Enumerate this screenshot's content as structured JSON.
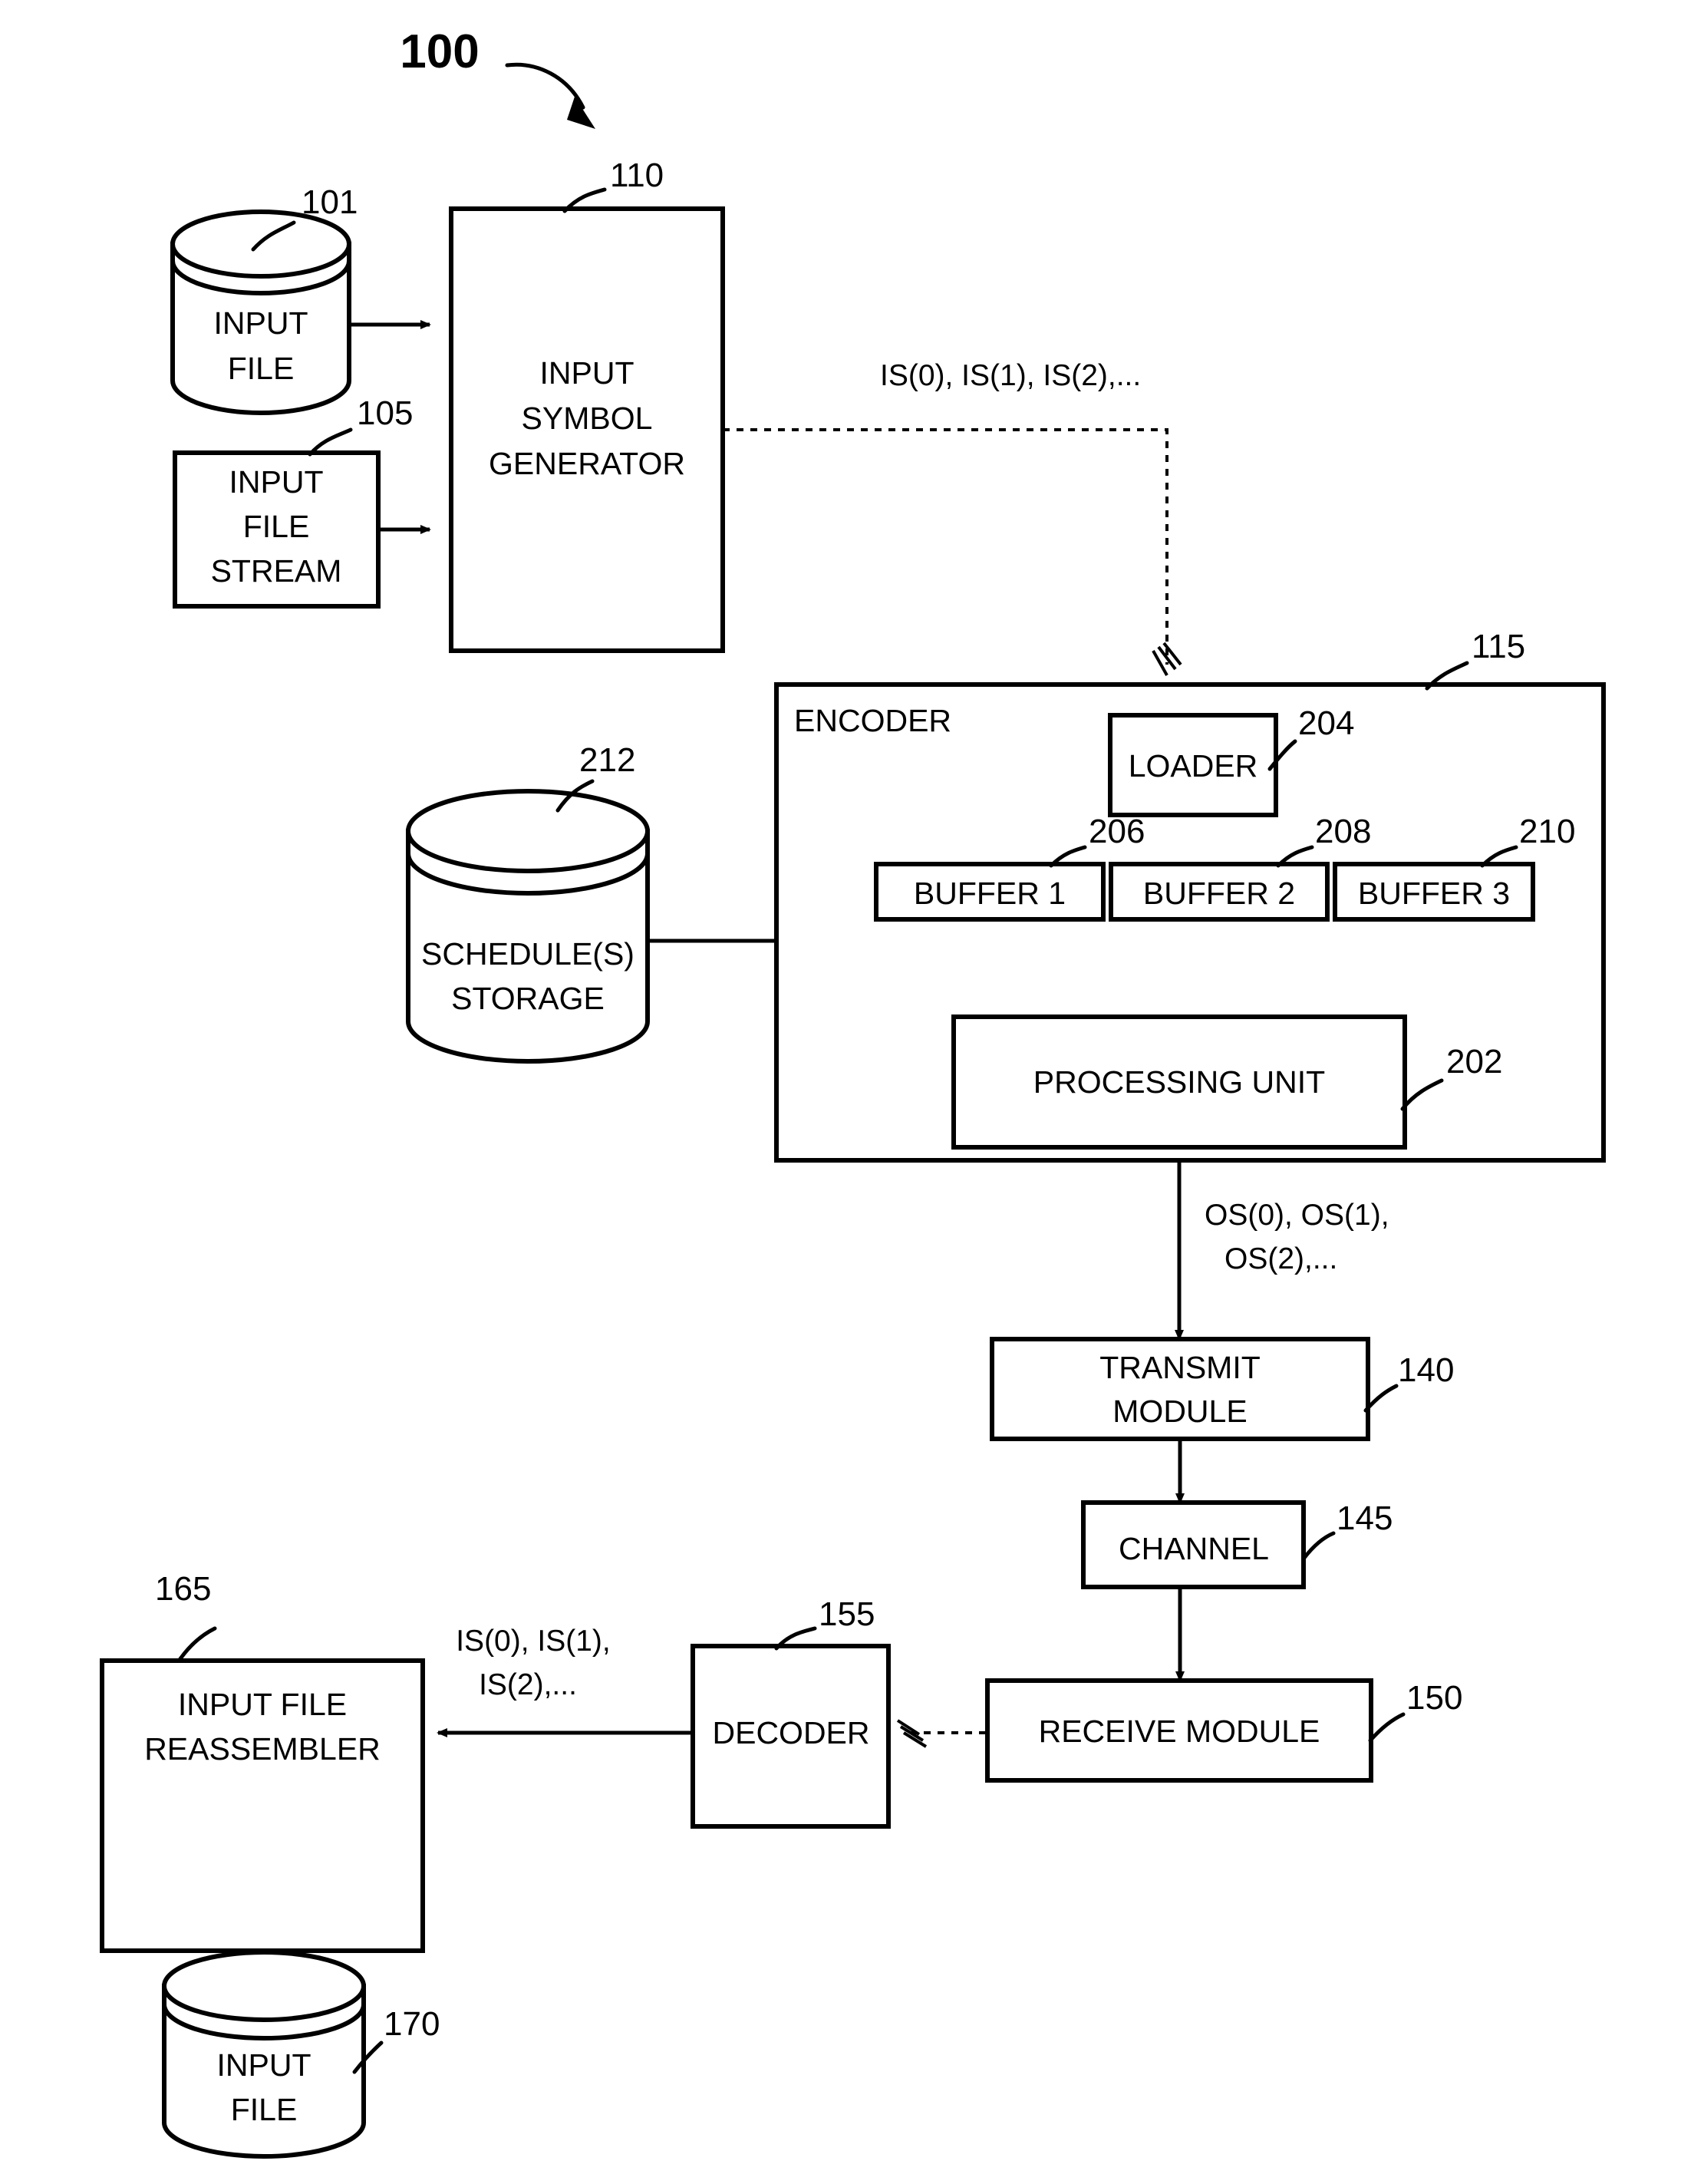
{
  "figure": {
    "number": "100",
    "title_ref": "100"
  },
  "nodes": {
    "input_file_top": {
      "label_line1": "INPUT",
      "label_line2": "FILE",
      "ref": "101"
    },
    "input_file_stream": {
      "label_line1": "INPUT",
      "label_line2": "FILE",
      "label_line3": "STREAM",
      "ref": "105"
    },
    "input_symbol_generator": {
      "label_line1": "INPUT",
      "label_line2": "SYMBOL",
      "label_line3": "GENERATOR",
      "ref": "110"
    },
    "encoder": {
      "label": "ENCODER",
      "ref": "115"
    },
    "loader": {
      "label": "LOADER",
      "ref": "204"
    },
    "buffer1": {
      "label": "BUFFER 1",
      "ref": "206"
    },
    "buffer2": {
      "label": "BUFFER 2",
      "ref": "208"
    },
    "buffer3": {
      "label": "BUFFER 3",
      "ref": "210"
    },
    "processing_unit": {
      "label": "PROCESSING UNIT",
      "ref": "202"
    },
    "schedules_storage": {
      "label_line1": "SCHEDULE(S)",
      "label_line2": "STORAGE",
      "ref": "212"
    },
    "transmit_module": {
      "label_line1": "TRANSMIT",
      "label_line2": "MODULE",
      "ref": "140"
    },
    "channel": {
      "label": "CHANNEL",
      "ref": "145"
    },
    "receive_module": {
      "label": "RECEIVE MODULE",
      "ref": "150"
    },
    "decoder": {
      "label": "DECODER",
      "ref": "155"
    },
    "input_file_reassembler": {
      "label_line1": "INPUT FILE",
      "label_line2": "REASSEMBLER",
      "ref": "165"
    },
    "input_file_bottom": {
      "label_line1": "INPUT",
      "label_line2": "FILE",
      "ref": "170"
    }
  },
  "edge_labels": {
    "isg_to_encoder": "IS(0), IS(1), IS(2),...",
    "encoder_to_transmit_line1": "OS(0), OS(1),",
    "encoder_to_transmit_line2": "OS(2),...",
    "decoder_to_reassembler_line1": "IS(0), IS(1),",
    "decoder_to_reassembler_line2": "IS(2),..."
  },
  "colors": {
    "line": "#000000",
    "background": "#ffffff"
  }
}
